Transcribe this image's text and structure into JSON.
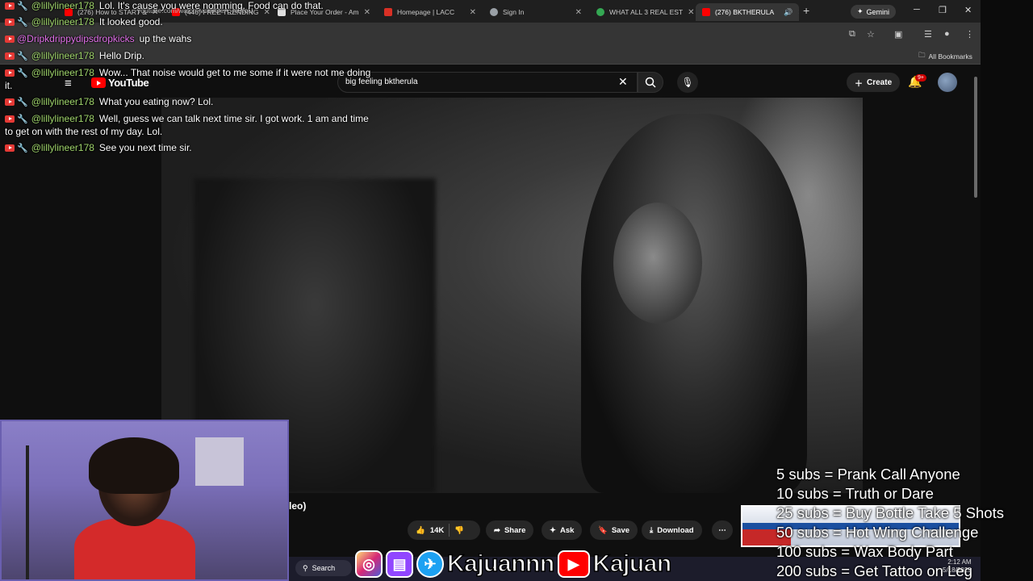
{
  "browser": {
    "tabs": [
      {
        "label": "(276) How to START &",
        "color": "#ff0000"
      },
      {
        "label": "(446) FREE TRENDING",
        "color": "#ff0000"
      },
      {
        "label": "Place Your Order - Am",
        "color": "#e0e0e0"
      },
      {
        "label": "Homepage | LACC",
        "color": "#d93025"
      },
      {
        "label": "Sign In",
        "color": "#9aa0a6"
      },
      {
        "label": "WHAT ALL 3 REAL EST",
        "color": "#34a853"
      },
      {
        "label": "(276) BKTHERULA",
        "color": "#ff0000"
      }
    ],
    "new_tab": "+",
    "gemini": "Gemini",
    "url": "youtube.com/watch?v=k9OeA_NUtoU",
    "all_bookmarks": "All Bookmarks"
  },
  "youtube": {
    "logo": "YouTube",
    "search_query": "big feeling bktherula",
    "create_label": "Create",
    "notif_badge": "9+",
    "title_fragment": "leo)",
    "likes": "14K",
    "share": "Share",
    "ask": "Ask",
    "save": "Save",
    "download": "Download"
  },
  "taskbar": {
    "search": "Search"
  },
  "chat": [
    {
      "user": "@lillylineer178",
      "text": "Lol. It's cause you were nomming. Food can do that.",
      "pink": false
    },
    {
      "user": "@lillylineer178",
      "text": "It looked good.",
      "pink": false
    },
    {
      "user": "@Dripkdrippydipsdropkicks",
      "text": "up the wahs",
      "pink": true
    },
    {
      "user": "@lillylineer178",
      "text": "Hello Drip.",
      "pink": false
    },
    {
      "user": "@lillylineer178",
      "text": "Wow... That noise would get to me some if it were not me doing",
      "pink": false
    },
    {
      "user": "@lillylineer178",
      "text": "What you eating now? Lol.",
      "pink": false
    },
    {
      "user": "@lillylineer178",
      "text": "Well, guess we can talk next time sir. I got work. 1 am and time",
      "pink": false
    },
    {
      "user": "@lillylineer178",
      "text": "See you next time sir.",
      "pink": false
    }
  ],
  "chat_cont": {
    "line1": "it.",
    "line2": "to get on with the rest of my day. Lol."
  },
  "overlay": {
    "social_name_1": "Kajuannn",
    "social_name_2": "Kajuan",
    "goals": [
      "5 subs =  Prank Call Anyone",
      "10 subs = Truth or Dare",
      "25 subs = Buy Bottle Take 5 Shots",
      "50 subs = Hot Wing Challenge",
      "100 subs = Wax Body Part",
      "200 subs = Get Tattoo on Leg"
    ],
    "clock_time": "2:12 AM",
    "clock_date": "5/18/2025"
  },
  "colors": {
    "yt_red": "#ff0000",
    "chat_user": "#9ed36a",
    "chat_user_pink": "#e070e8",
    "webcam_bg": "#7a6eb8"
  }
}
